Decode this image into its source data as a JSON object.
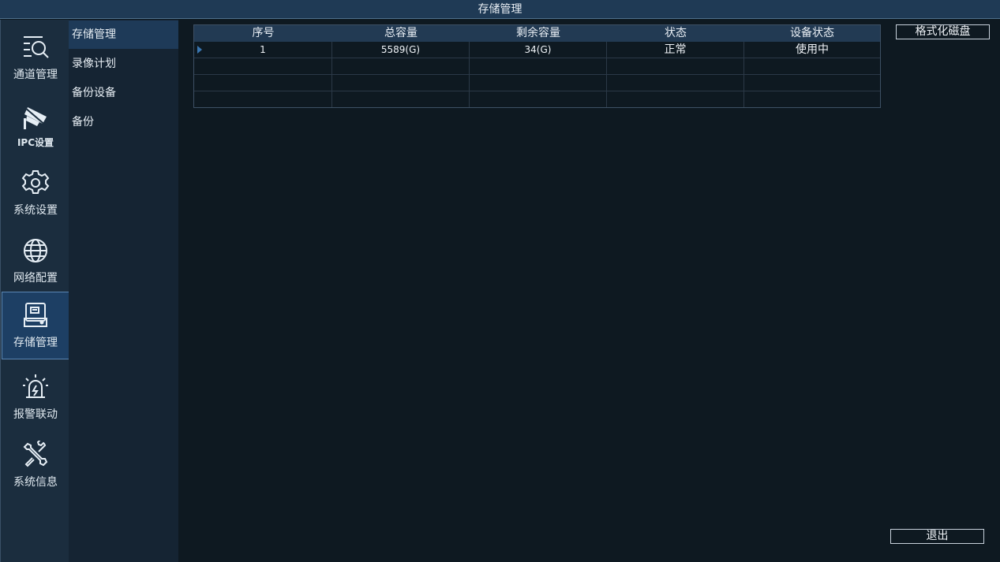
{
  "window": {
    "title": "存储管理"
  },
  "sidebar": {
    "items": [
      {
        "label": "通道管理",
        "icon": "channel-search-icon",
        "active": false
      },
      {
        "label": "IPC设置",
        "icon": "camera-icon",
        "active": false
      },
      {
        "label": "系统设置",
        "icon": "gear-icon",
        "active": false
      },
      {
        "label": "网络配置",
        "icon": "globe-icon",
        "active": false
      },
      {
        "label": "存储管理",
        "icon": "hard-disk-icon",
        "active": true
      },
      {
        "label": "报警联动",
        "icon": "alarm-light-icon",
        "active": false
      },
      {
        "label": "系统信息",
        "icon": "tools-icon",
        "active": false
      }
    ]
  },
  "subnav": {
    "items": [
      {
        "label": "存储管理",
        "active": true
      },
      {
        "label": "录像计划",
        "active": false
      },
      {
        "label": "备份设备",
        "active": false
      },
      {
        "label": "备份",
        "active": false
      }
    ]
  },
  "disk_table": {
    "columns": [
      "序号",
      "总容量",
      "剩余容量",
      "状态",
      "设备状态"
    ],
    "rows": [
      [
        "1",
        "5589(G)",
        "34(G)",
        "正常",
        "使用中"
      ],
      [
        "",
        "",
        "",
        "",
        ""
      ],
      [
        "",
        "",
        "",
        "",
        ""
      ],
      [
        "",
        "",
        "",
        "",
        ""
      ]
    ]
  },
  "buttons": {
    "format_disk": "格式化磁盘",
    "exit": "退出"
  },
  "colors": {
    "accent": "#1d3f64",
    "header": "#223a53",
    "background": "#0e1921"
  }
}
